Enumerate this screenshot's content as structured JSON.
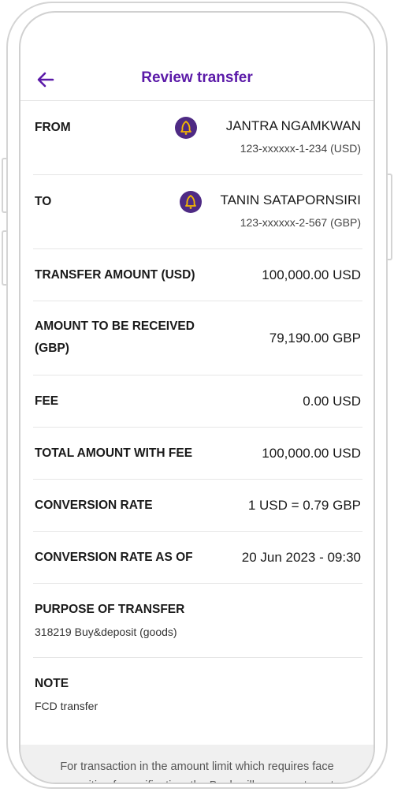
{
  "header": {
    "title": "Review transfer"
  },
  "from": {
    "label": "FROM",
    "name": "JANTRA NGAMKWAN",
    "account": "123-xxxxxx-1-234 (USD)"
  },
  "to": {
    "label": "TO",
    "name": "TANIN SATAPORNSIRI",
    "account": "123-xxxxxx-2-567 (GBP)"
  },
  "rows": [
    {
      "label": "TRANSFER AMOUNT (USD)",
      "value": "100,000.00 USD"
    },
    {
      "label": "AMOUNT TO BE RECEIVED",
      "label2": "(GBP)",
      "value": "79,190.00 GBP"
    },
    {
      "label": "FEE",
      "value": "0.00 USD"
    },
    {
      "label": "TOTAL AMOUNT WITH FEE",
      "value": "100,000.00 USD"
    },
    {
      "label": "CONVERSION RATE",
      "value": "1 USD = 0.79 GBP"
    },
    {
      "label": "CONVERSION RATE AS OF",
      "value": "20 Jun 2023 - 09:30"
    }
  ],
  "purpose": {
    "label": "PURPOSE OF TRANSFER",
    "value": "318219 Buy&deposit (goods)"
  },
  "note": {
    "label": "NOTE",
    "value": "FCD transfer"
  },
  "footer": {
    "text": "For transaction in the amount limit which requires face recognition for verification, the Bank will use counter rate"
  },
  "colors": {
    "accent": "#5b1aa8",
    "logo": "#4e2a84",
    "logo_symbol": "#f5b800"
  },
  "icons": {
    "back": "arrow-left-icon",
    "bank": "bank-logo-icon"
  }
}
